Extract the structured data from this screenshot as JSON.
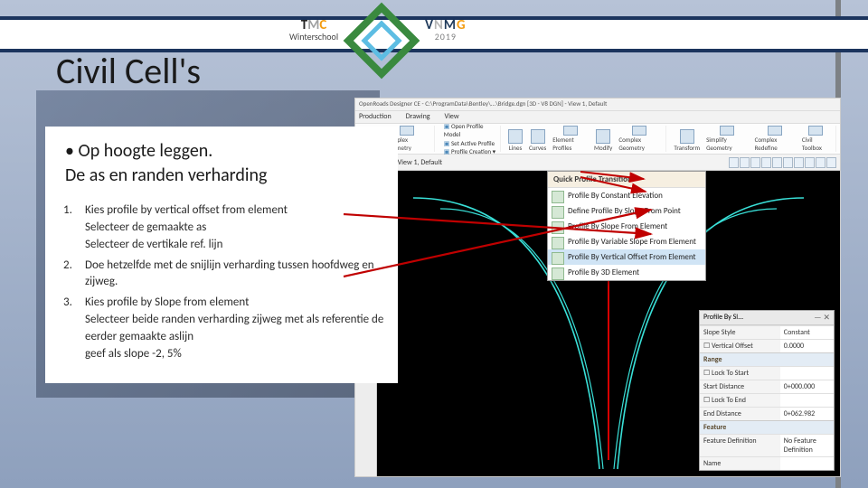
{
  "header": {
    "tmc_initials": "TMC",
    "tmc_sub": "Winterschool",
    "vnmg": "VNMG",
    "vnmg_year": "2019"
  },
  "title": "Civil Cell's",
  "bullet": "Op hoogte leggen.\nDe as en randen verharding",
  "steps": [
    "Kies profile by vertical offset from element\nSelecteer de gemaakte as\nSelecteer de vertikale ref. lijn",
    "Doe hetzelfde met de snijlijn verharding tussen hoofdweg en zijweg.",
    "Kies profile by Slope from element\nSelecteer beide randen verharding zijweg met als referentie de eerder gemaakte aslijn\ngeef als slope -2, 5%"
  ],
  "app": {
    "titlebar": "OpenRoads Designer CE - C:\\ProgramData\\Bentley\\...\\Bridge.dgn [3D - V8 DGN] - View 1, Default",
    "tabs": [
      "Production",
      "Drawing",
      "View"
    ],
    "ribbon_text": [
      "Open Profile Model",
      "Set Active Profile",
      "Profile Creation ▾"
    ],
    "ribbon_items": [
      "Modify",
      "Complex Geometry",
      "Lines",
      "Curves",
      "Element Profiles",
      "Modify",
      "Complex Geometry",
      "Transform",
      "Simplify Geometry",
      "Complex Redefine",
      "Civil Toolbox"
    ],
    "view_label": "View 1, Default",
    "dropdown_header": "Quick Profile Transition",
    "dropdown_items": [
      "Profile By Constant Elevation",
      "Define Profile By Slope From Point",
      "Profile By Slope From Element",
      "Profile By Variable Slope From Element",
      "Profile By Vertical Offset From Element",
      "Profile By 3D Element"
    ],
    "palette": {
      "title": "Profile By Sl...",
      "rows": [
        {
          "k": "Slope Style",
          "v": "Constant"
        },
        {
          "k": "Vertical Offset",
          "v": "0.0000",
          "chk": true
        }
      ],
      "section1": "Range",
      "rows2": [
        {
          "k": "Lock To Start",
          "v": "",
          "chk": true
        },
        {
          "k": "Start Distance",
          "v": "0+000.000"
        },
        {
          "k": "Lock To End",
          "v": "",
          "chk": true
        },
        {
          "k": "End Distance",
          "v": "0+062.982"
        }
      ],
      "section2": "Feature",
      "rows3": [
        {
          "k": "Feature Definition",
          "v": "No Feature Definition"
        },
        {
          "k": "Name",
          "v": ""
        }
      ]
    }
  }
}
